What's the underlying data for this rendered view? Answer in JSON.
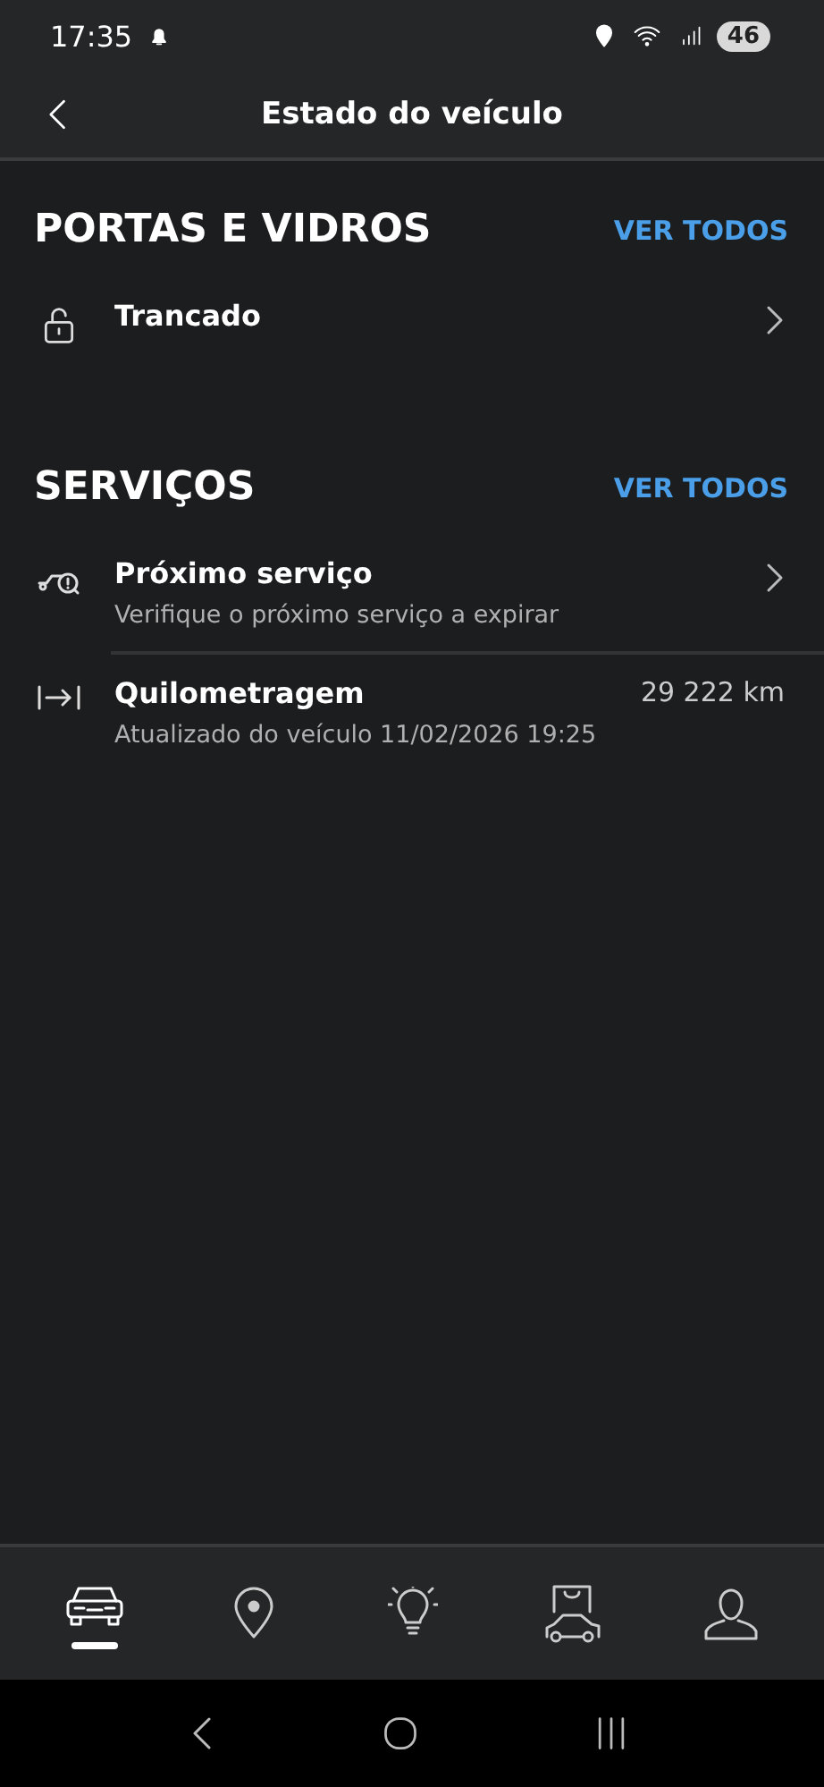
{
  "status_bar": {
    "time": "17:35",
    "battery": "46"
  },
  "header": {
    "title": "Estado do veículo"
  },
  "sections": [
    {
      "title": "PORTAS E VIDROS",
      "action": "VER TODOS",
      "items": [
        {
          "kind": "lock",
          "title": "Trancado",
          "chevron": true
        }
      ]
    },
    {
      "title": "SERVIÇOS",
      "action": "VER TODOS",
      "items": [
        {
          "kind": "service",
          "title": "Próximo serviço",
          "subtitle": "Verifique o próximo serviço a expirar",
          "chevron": true
        },
        {
          "kind": "mileage",
          "title": "Quilometragem",
          "subtitle": "Atualizado do veículo 11/02/2026 19:25",
          "value": "29 222 km",
          "chevron": false
        }
      ]
    }
  ],
  "bottom_nav": [
    {
      "kind": "car",
      "selected": true
    },
    {
      "kind": "map",
      "selected": false
    },
    {
      "kind": "ideas",
      "selected": false
    },
    {
      "kind": "shop",
      "selected": false
    },
    {
      "kind": "profile",
      "selected": false
    }
  ]
}
